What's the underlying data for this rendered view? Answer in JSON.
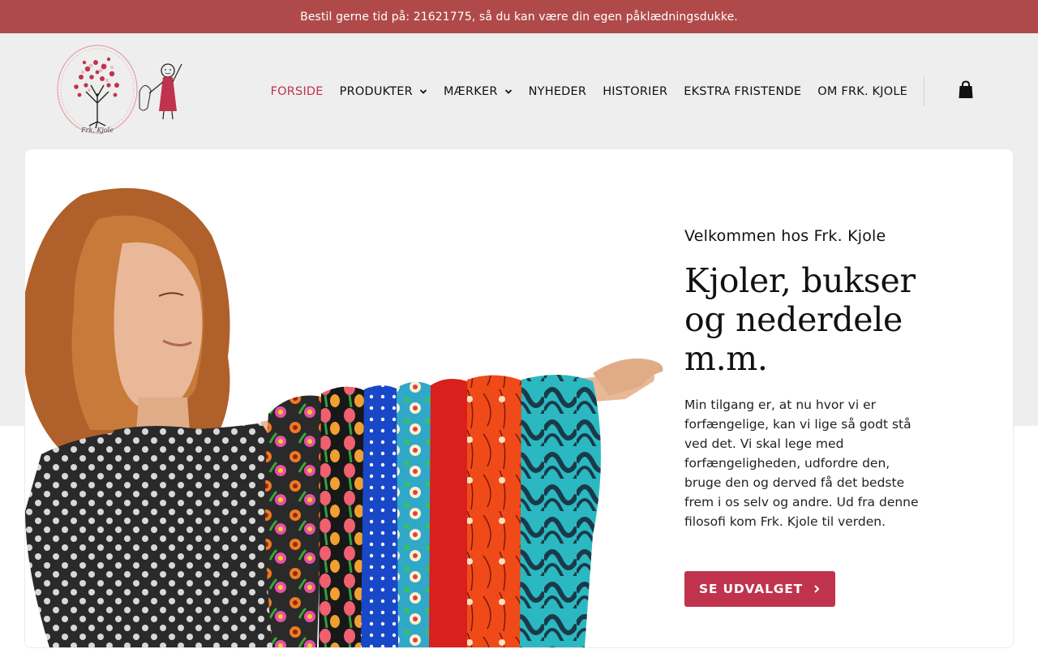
{
  "topbar": {
    "message": "Bestil gerne tid på: 21621775, så du kan være din egen påklædningsdukke."
  },
  "header": {
    "logo_text": "Frk. Kjole",
    "nav": [
      {
        "label": "FORSIDE",
        "active": true,
        "dropdown": false
      },
      {
        "label": "PRODUKTER",
        "active": false,
        "dropdown": true
      },
      {
        "label": "MÆRKER",
        "active": false,
        "dropdown": true
      },
      {
        "label": "NYHEDER",
        "active": false,
        "dropdown": false
      },
      {
        "label": "HISTORIER",
        "active": false,
        "dropdown": false
      },
      {
        "label": "EKSTRA FRISTENDE",
        "active": false,
        "dropdown": false
      },
      {
        "label": "OM FRK. KJOLE",
        "active": false,
        "dropdown": false
      }
    ],
    "cart_icon": "shopping-bag-icon"
  },
  "hero": {
    "eyebrow": "Velkommen hos Frk. Kjole",
    "headline": "Kjoler, bukser og nederdele m.m.",
    "body": "Min tilgang er, at nu hvor vi er forfængelige, kan vi lige så godt stå ved det. Vi skal lege med forfængeligheden, udfordre den, bruge den og derved få det bedste frem i os selv og andre. Ud fra denne filosofi kom Frk. Kjole til verden.",
    "cta_label": "SE UDVALGET"
  },
  "colors": {
    "topbar_bg": "#b04a4a",
    "accent": "#c0334d",
    "band_bg": "#eeeeee"
  }
}
